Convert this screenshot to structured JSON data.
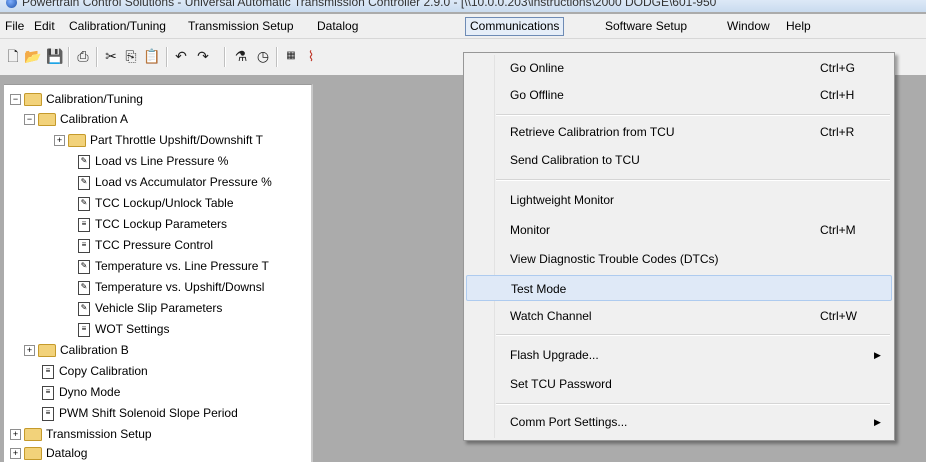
{
  "window": {
    "title": "Powertrain Control Solutions - Universal Automatic Transmission Controller 2.9.0 - [\\\\10.0.0.203\\instructions\\2000 DODGE\\601-950"
  },
  "menubar": {
    "items": [
      "File",
      "Edit",
      "Calibration/Tuning",
      "Transmission Setup",
      "Datalog",
      "Communications",
      "Software Setup",
      "Window",
      "Help"
    ]
  },
  "toolbar": {
    "icons": [
      "new-icon",
      "open-icon",
      "save-icon",
      "print-icon",
      "cut-icon",
      "copy-icon",
      "paste-icon",
      "undo-icon",
      "redo-icon",
      "wizard-icon",
      "gauge-icon",
      "binary-icon",
      "chart-icon"
    ]
  },
  "tree": {
    "items": [
      {
        "label": "Calibration/Tuning",
        "type": "folder",
        "expander": "-"
      },
      {
        "label": "Calibration A",
        "type": "folder",
        "expander": "-"
      },
      {
        "label": "Part Throttle Upshift/Downshift T",
        "type": "folder",
        "expander": "+"
      },
      {
        "label": "Load vs Line Pressure %",
        "type": "table"
      },
      {
        "label": "Load vs Accumulator Pressure %",
        "type": "table"
      },
      {
        "label": "TCC Lockup/Unlock Table",
        "type": "table"
      },
      {
        "label": "TCC Lockup Parameters",
        "type": "params"
      },
      {
        "label": "TCC Pressure Control",
        "type": "params"
      },
      {
        "label": "Temperature vs. Line Pressure T",
        "type": "table"
      },
      {
        "label": "Temperature vs. Upshift/Downsl",
        "type": "table"
      },
      {
        "label": "Vehicle Slip Parameters",
        "type": "table"
      },
      {
        "label": "WOT Settings",
        "type": "params"
      },
      {
        "label": "Calibration B",
        "type": "folder",
        "expander": "+"
      },
      {
        "label": "Copy Calibration",
        "type": "params"
      },
      {
        "label": "Dyno Mode",
        "type": "params"
      },
      {
        "label": "PWM Shift Solenoid Slope Period",
        "type": "params"
      },
      {
        "label": "Transmission Setup",
        "type": "folder",
        "expander": "+"
      },
      {
        "label": "Datalog",
        "type": "folder",
        "expander": "+"
      }
    ]
  },
  "communications_menu": {
    "items": [
      {
        "label": "Go Online",
        "shortcut": "Ctrl+G"
      },
      {
        "label": "Go Offline",
        "shortcut": "Ctrl+H"
      },
      {
        "label": "Retrieve Calibratrion from TCU",
        "shortcut": "Ctrl+R"
      },
      {
        "label": "Send Calibration to TCU",
        "shortcut": ""
      },
      {
        "label": "Lightweight Monitor",
        "shortcut": ""
      },
      {
        "label": "Monitor",
        "shortcut": "Ctrl+M"
      },
      {
        "label": "View Diagnostic Trouble Codes (DTCs)",
        "shortcut": ""
      },
      {
        "label": "Test Mode",
        "shortcut": "",
        "highlighted": true
      },
      {
        "label": "Watch Channel",
        "shortcut": "Ctrl+W"
      },
      {
        "label": "Flash Upgrade...",
        "shortcut": "",
        "submenu": true
      },
      {
        "label": "Set TCU Password",
        "shortcut": ""
      },
      {
        "label": "Comm Port Settings...",
        "shortcut": "",
        "submenu": true
      }
    ]
  },
  "colors": {
    "workspace": "#ababab",
    "menu_bg": "#f0f0f0",
    "highlight": "#dfe9f7"
  }
}
